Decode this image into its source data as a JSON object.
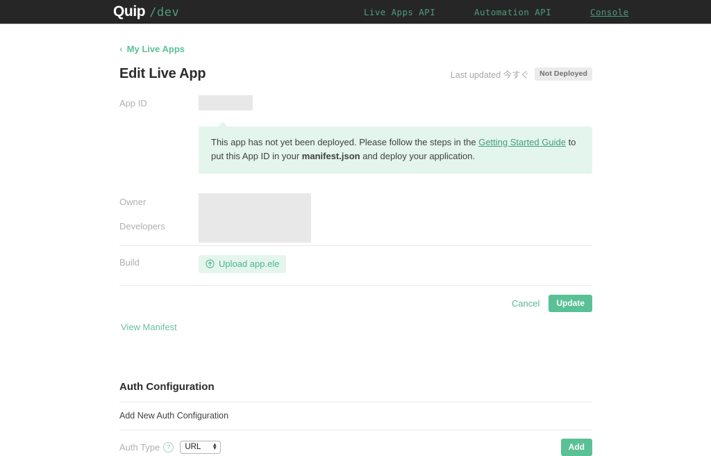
{
  "header": {
    "brand_name": "Quip",
    "brand_suffix": "/dev",
    "nav": [
      {
        "label": "Live Apps API",
        "active": false
      },
      {
        "label": "Automation API",
        "active": false
      },
      {
        "label": "Console",
        "active": true
      }
    ]
  },
  "breadcrumb": {
    "back_icon": "‹",
    "label": "My Live Apps"
  },
  "main": {
    "title": "Edit Live App",
    "last_updated_label": "Last updated 今すぐ",
    "status_badge": "Not Deployed",
    "fields": {
      "app_id_label": "App ID",
      "owner_label": "Owner",
      "developers_label": "Developers",
      "build_label": "Build"
    },
    "callout": {
      "text_before_link": "This app has not yet been deployed. Please follow the steps in the ",
      "link_label": "Getting Started Guide",
      "text_after_link": " to put this App ID in your ",
      "bold_term": "manifest.json",
      "text_end": " and deploy your application."
    },
    "upload_button": {
      "icon": "↑",
      "label": "Upload app.ele"
    },
    "cancel_label": "Cancel",
    "update_label": "Update",
    "view_manifest_label": "View Manifest"
  },
  "auth": {
    "section_title": "Auth Configuration",
    "sub_title": "Add New Auth Configuration",
    "auth_type_label": "Auth Type",
    "help_icon": "?",
    "auth_type_value": "URL",
    "auth_type_options": [
      "URL"
    ],
    "add_label": "Add"
  },
  "colors": {
    "accent": "#5ac196",
    "accent_soft": "#e4f5ee",
    "header_bg": "#262626",
    "nav_link": "#4e9c7c",
    "badge_bg": "#ebebeb",
    "skeleton": "#e8e8e8"
  }
}
